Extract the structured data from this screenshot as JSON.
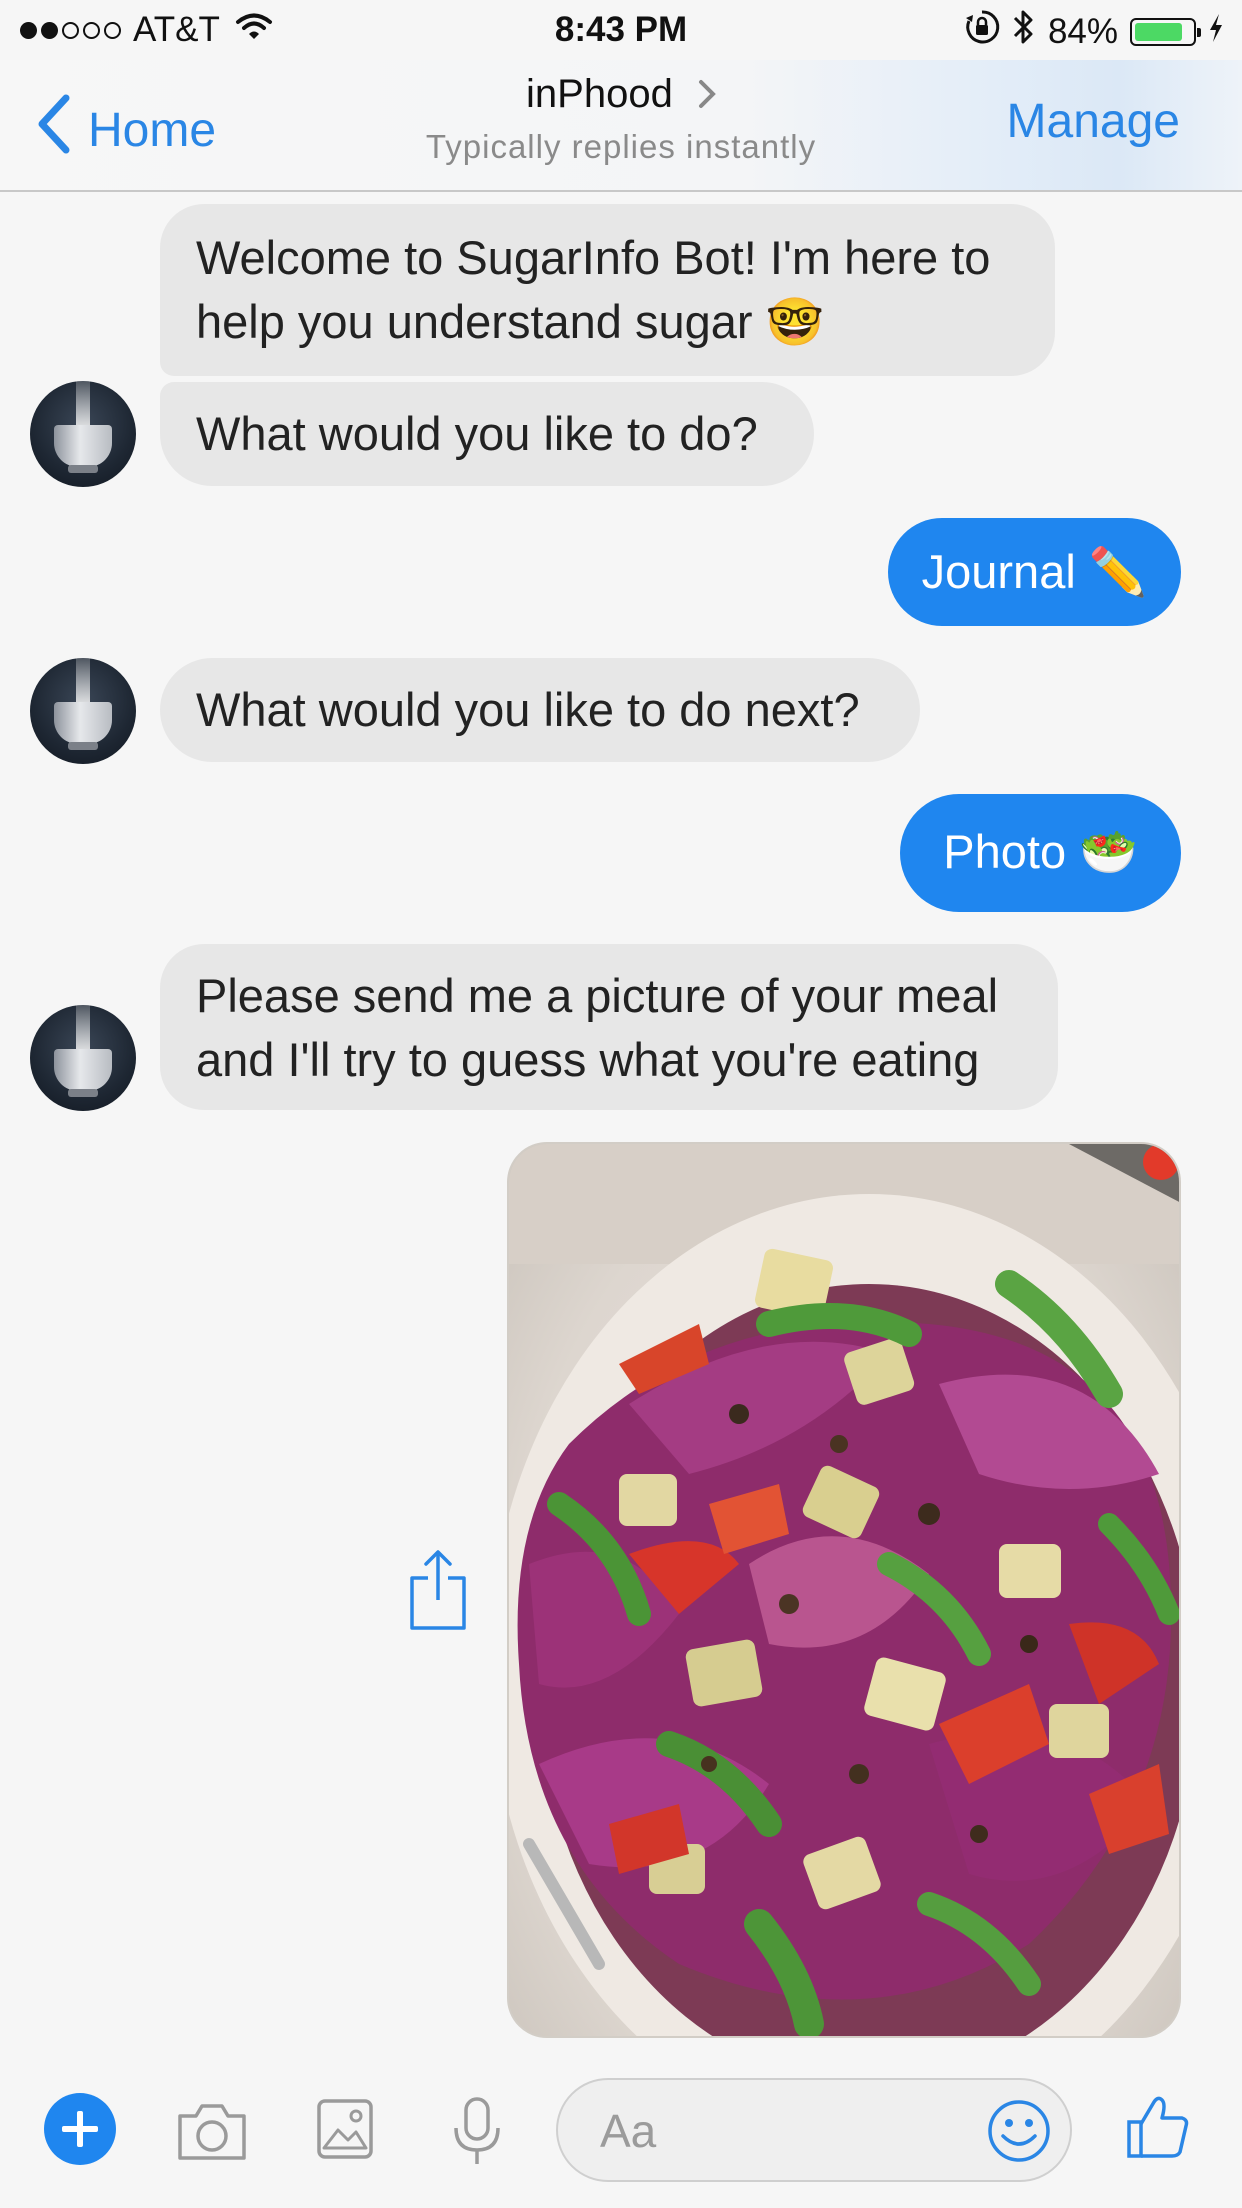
{
  "status_bar": {
    "carrier": "AT&T",
    "signal_filled": 2,
    "signal_total": 5,
    "time": "8:43 PM",
    "battery_percent_text": "84%",
    "battery_level": 0.84
  },
  "nav": {
    "back_label": "Home",
    "title": "inPhood",
    "subtitle": "Typically replies instantly",
    "manage_label": "Manage"
  },
  "messages": [
    {
      "from": "bot",
      "text": "Welcome to SugarInfo Bot! I'm here to help you understand sugar 🤓"
    },
    {
      "from": "bot",
      "text": "What would you like to do?"
    },
    {
      "from": "user",
      "text": "Journal ✏️"
    },
    {
      "from": "bot",
      "text": "What would you like to do next?"
    },
    {
      "from": "user",
      "text": "Photo 🥗"
    },
    {
      "from": "bot",
      "text": "Please send me a picture of your meal and I'll try to guess what you're eating"
    },
    {
      "from": "user",
      "type": "image",
      "image": "salad-photo"
    }
  ],
  "composer": {
    "placeholder": "Aa"
  },
  "colors": {
    "accent": "#1f86ef",
    "link": "#2a86e5",
    "incoming_bubble": "#e7e7e7",
    "background": "#f6f6f6"
  }
}
